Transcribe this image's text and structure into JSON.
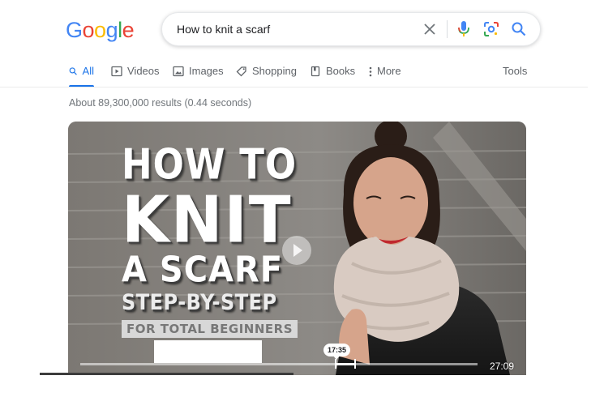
{
  "logo": {
    "letters": [
      "G",
      "o",
      "o",
      "g",
      "l",
      "e"
    ],
    "colors": [
      "#4285f4",
      "#ea4335",
      "#fbbc05",
      "#4285f4",
      "#34a853",
      "#ea4335"
    ]
  },
  "search": {
    "query": "How to knit a scarf"
  },
  "tabs": [
    {
      "label": "All",
      "icon": "search-icon",
      "active": true
    },
    {
      "label": "Videos",
      "icon": "video-icon"
    },
    {
      "label": "Images",
      "icon": "image-icon"
    },
    {
      "label": "Shopping",
      "icon": "tag-icon"
    },
    {
      "label": "Books",
      "icon": "book-icon"
    },
    {
      "label": "More",
      "icon": "more-vert-icon"
    }
  ],
  "tools_label": "Tools",
  "results_stats": "About 89,300,000 results (0.44 seconds)",
  "video": {
    "title_lines": [
      "HOW TO",
      "KNIT",
      "A SCARF",
      "STEP-BY-STEP",
      "FOR TOTAL BEGINNERS"
    ],
    "key_moment_time": "17:35",
    "duration": "27:09"
  },
  "colors": {
    "accent": "#1a73e8",
    "text_secondary": "#5f6368"
  }
}
